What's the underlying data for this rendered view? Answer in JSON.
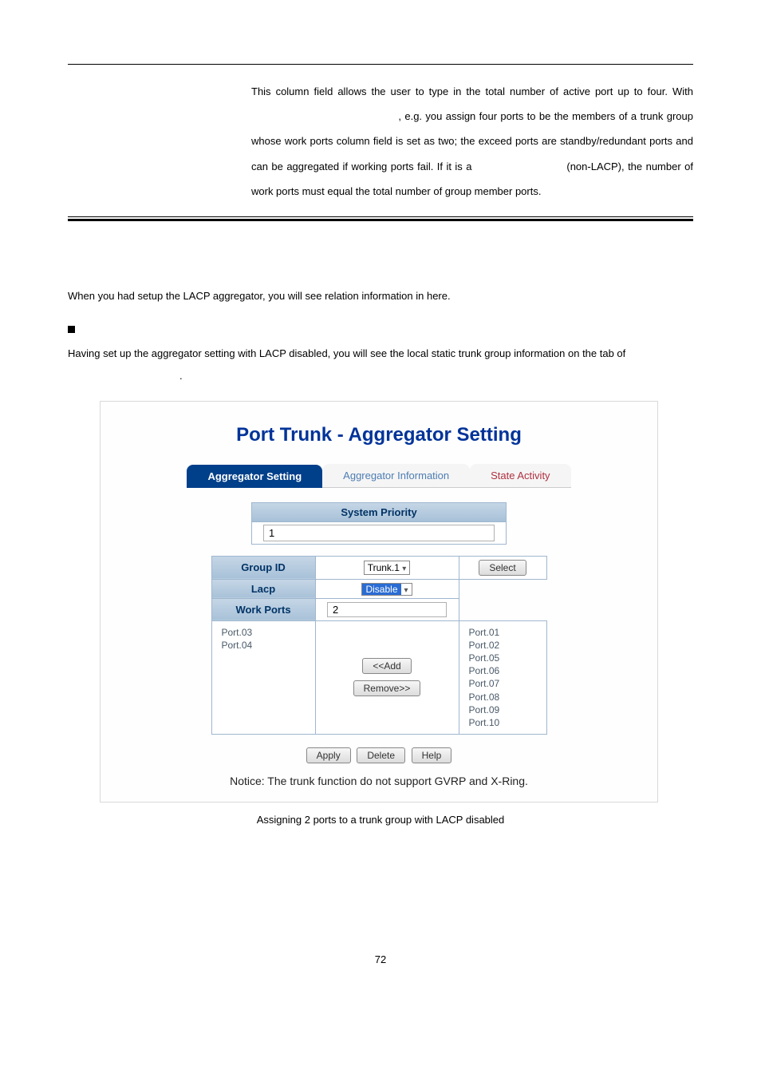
{
  "top_paragraph": {
    "l1a": "This column field allows the user to type in the total number of active port up to",
    "l2a": "four. With",
    "l2b": ", e.g. you assign four ports to be the",
    "l3": "members of a trunk group whose work ports column field is set as two; the",
    "l4": "exceed ports are standby/redundant ports and can be aggregated if working",
    "l5a": "ports fail. If it is a",
    "l5b": "(non-LACP), the number of work ports must",
    "l6": "equal the total number of group member ports."
  },
  "body1": "When you had setup the LACP aggregator, you will see relation information in here.",
  "body2": "Having set up the aggregator setting with LACP disabled, you will see the local static trunk group information on the tab of",
  "body2_trail": ".",
  "figure": {
    "title": "Port Trunk - Aggregator Setting",
    "tabs": {
      "active": "Aggregator Setting",
      "mid": "Aggregator Information",
      "last": "State Activity"
    },
    "sys_priority_label": "System Priority",
    "sys_priority_value": "1",
    "rows": {
      "group_id_label": "Group ID",
      "group_id_value": "Trunk.1",
      "select_btn": "Select",
      "lacp_label": "Lacp",
      "lacp_value": "Disable",
      "work_ports_label": "Work Ports",
      "work_ports_value": "2",
      "left_ports": "Port.03\nPort.04",
      "add_btn": "<<Add",
      "remove_btn": "Remove>>",
      "right_ports": [
        "Port.01",
        "Port.02",
        "Port.05",
        "Port.06",
        "Port.07",
        "Port.08",
        "Port.09",
        "Port.10"
      ]
    },
    "buttons": {
      "apply": "Apply",
      "delete": "Delete",
      "help": "Help"
    },
    "notice": "Notice: The trunk function do not support GVRP and X-Ring."
  },
  "caption": "Assigning 2 ports to a trunk group with LACP disabled",
  "page_number": "72"
}
